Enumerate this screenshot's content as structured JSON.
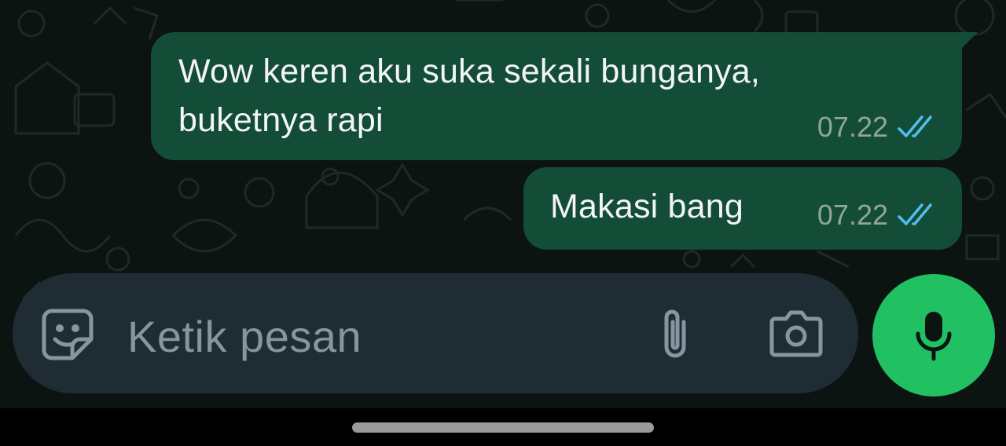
{
  "messages": [
    {
      "text": "Wow keren aku suka sekali bunganya,\nbuketnya rapi",
      "time": "07.22",
      "status": "read"
    },
    {
      "text": "Makasi bang",
      "time": "07.22",
      "status": "read"
    }
  ],
  "composer": {
    "placeholder": "Ketik pesan",
    "emoji_icon": "sticker-smile-icon",
    "attach_icon": "paperclip-icon",
    "camera_icon": "camera-icon",
    "mic_icon": "microphone-icon"
  },
  "colors": {
    "chat_background": "#0b1410",
    "outgoing_bubble": "#144d37",
    "read_ticks": "#53bdeb",
    "composer_background": "#1f2c33",
    "mic_button": "#21c063"
  }
}
